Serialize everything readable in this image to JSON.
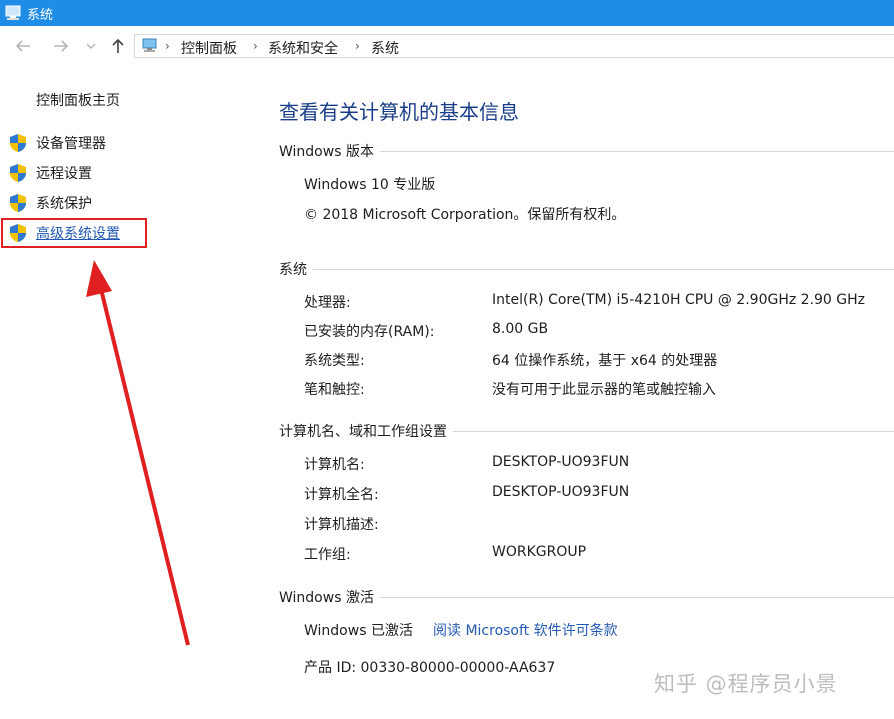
{
  "window": {
    "title": "系统"
  },
  "breadcrumb": [
    "控制面板",
    "系统和安全",
    "系统"
  ],
  "sidebar": {
    "home": "控制面板主页",
    "items": [
      {
        "label": "设备管理器"
      },
      {
        "label": "远程设置"
      },
      {
        "label": "系统保护"
      },
      {
        "label": "高级系统设置"
      }
    ]
  },
  "main": {
    "title": "查看有关计算机的基本信息",
    "edition": {
      "header": "Windows 版本",
      "name": "Windows 10 专业版",
      "copyright": "© 2018 Microsoft Corporation。保留所有权利。"
    },
    "system": {
      "header": "系统",
      "rows": [
        {
          "label": "处理器:",
          "value": "Intel(R) Core(TM) i5-4210H CPU @ 2.90GHz   2.90 GHz"
        },
        {
          "label": "已安装的内存(RAM):",
          "value": "8.00 GB"
        },
        {
          "label": "系统类型:",
          "value": "64 位操作系统，基于 x64 的处理器"
        },
        {
          "label": "笔和触控:",
          "value": "没有可用于此显示器的笔或触控输入"
        }
      ]
    },
    "computer": {
      "header": "计算机名、域和工作组设置",
      "rows": [
        {
          "label": "计算机名:",
          "value": "DESKTOP-UO93FUN"
        },
        {
          "label": "计算机全名:",
          "value": "DESKTOP-UO93FUN"
        },
        {
          "label": "计算机描述:",
          "value": ""
        },
        {
          "label": "工作组:",
          "value": "WORKGROUP"
        }
      ]
    },
    "activation": {
      "header": "Windows 激活",
      "status": "Windows 已激活",
      "license_link": "阅读 Microsoft 软件许可条款",
      "product_id": "产品 ID: 00330-80000-00000-AA637"
    }
  },
  "watermark": "知乎 @程序员小景",
  "colors": {
    "titlebar": "#1f8ce6",
    "heading": "#1a3d8a",
    "link": "#2359b3",
    "annotation": "#e02020"
  },
  "icons": [
    "system-icon",
    "back-arrow-icon",
    "forward-arrow-icon",
    "chevron-down-icon",
    "up-arrow-icon",
    "computer-icon",
    "shield-icon"
  ]
}
